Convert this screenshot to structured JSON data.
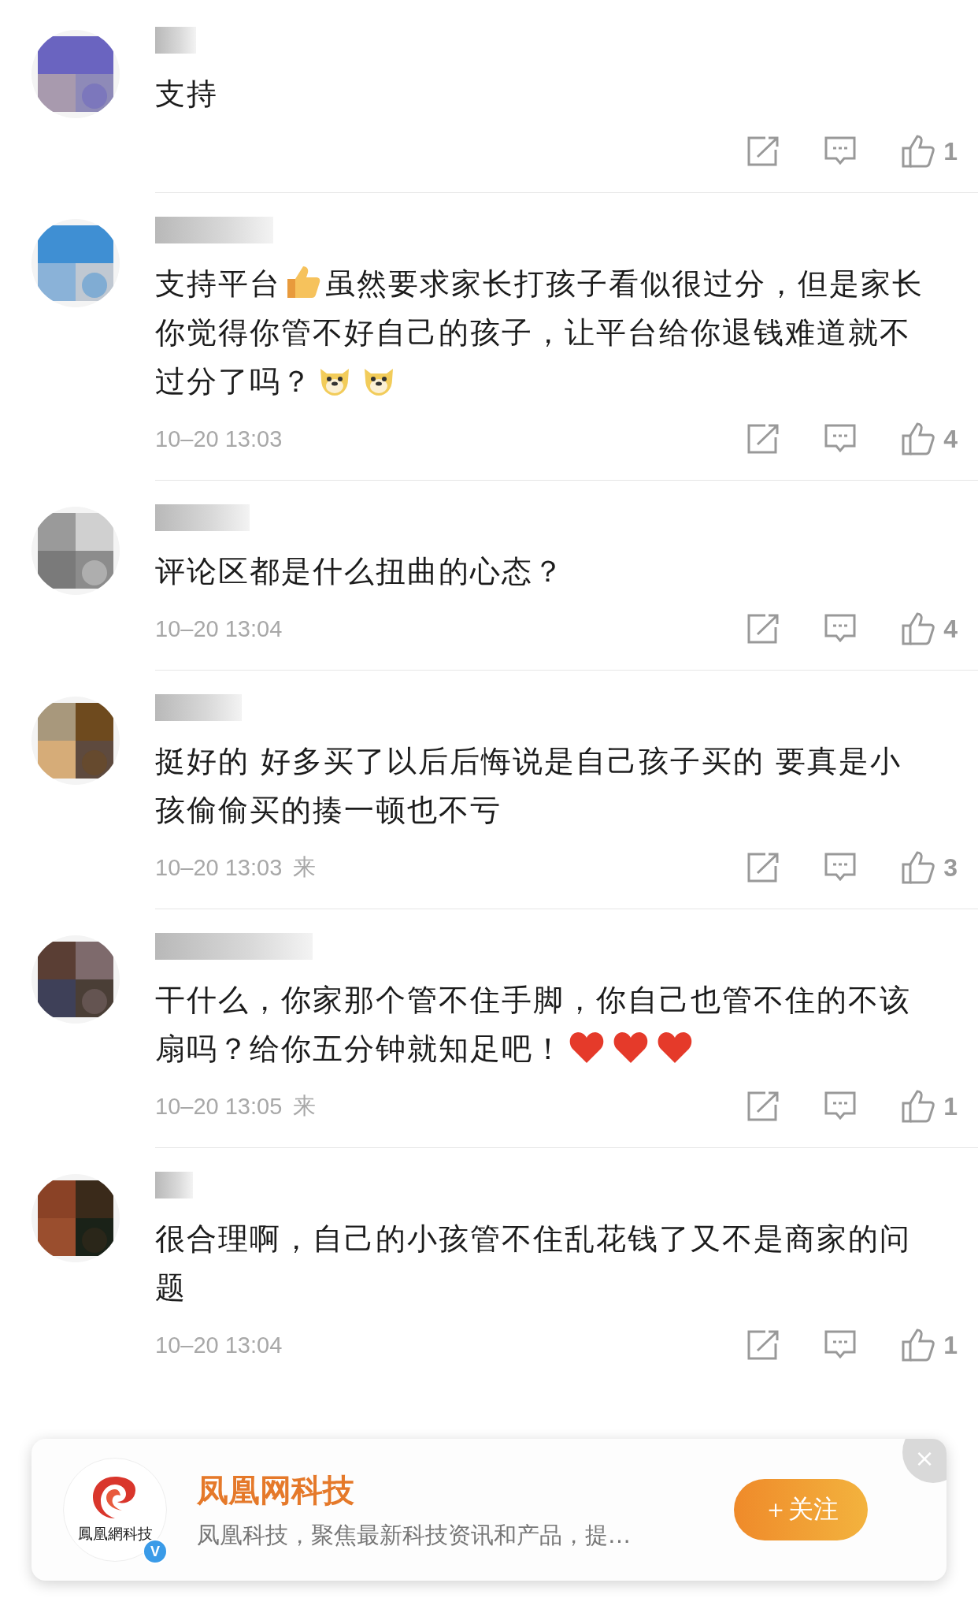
{
  "comments": [
    {
      "segments": [
        {
          "kind": "text",
          "text": "支持"
        }
      ],
      "likes": "1"
    },
    {
      "segments": [
        {
          "kind": "text",
          "text": "支持平台"
        },
        {
          "kind": "thumb"
        },
        {
          "kind": "text",
          "text": "虽然要求家长打孩子看似很过分，但是家长你觉得你管不好自己的孩子，让平台给你退钱难道就不过分了吗？"
        },
        {
          "kind": "doge"
        },
        {
          "kind": "doge"
        }
      ],
      "time": "10–20 13:03",
      "likes": "4"
    },
    {
      "segments": [
        {
          "kind": "text",
          "text": "评论区都是什么扭曲的心态？"
        }
      ],
      "time": "10–20 13:04",
      "likes": "4"
    },
    {
      "segments": [
        {
          "kind": "text",
          "text": "挺好的 好多买了以后后悔说是自己孩子买的 要真是小孩偷偷买的揍一顿也不亏"
        }
      ],
      "time": "10–20 13:03",
      "source": "来",
      "likes": "3"
    },
    {
      "segments": [
        {
          "kind": "text",
          "text": "干什么，你家那个管不住手脚，你自己也管不住的不该扇吗？给你五分钟就知足吧！"
        },
        {
          "kind": "heart"
        },
        {
          "kind": "heart"
        },
        {
          "kind": "heart"
        }
      ],
      "time": "10–20 13:05",
      "source": "来",
      "likes": "1"
    },
    {
      "segments": [
        {
          "kind": "text",
          "text": "很合理啊，自己的小孩管不住乱花钱了又不是商家的问题"
        }
      ],
      "time": "10–20 13:04",
      "likes": "1"
    }
  ],
  "card": {
    "logo_text": "鳳凰網科技",
    "verified": "V",
    "title": "凤凰网科技",
    "description": "凤凰科技，聚焦最新科技资讯和产品，提…",
    "follow": "＋关注",
    "close": "×"
  }
}
